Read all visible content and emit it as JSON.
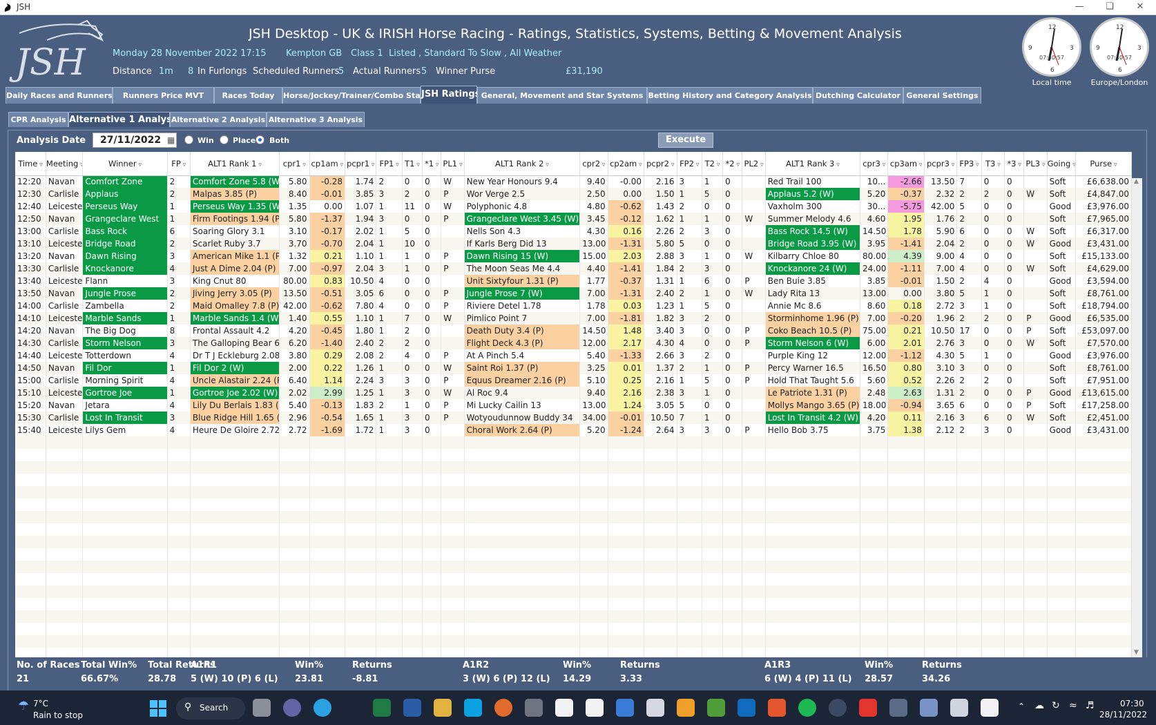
{
  "window": {
    "title": "JSH"
  },
  "header": {
    "title": "JSH Desktop - UK & IRISH Horse Racing  -  Ratings, Statistics, Systems, Betting & Movement Analysis",
    "date_time": "Monday 28 November 2022  17:15",
    "course": "Kempton  GB",
    "class": "Class 1",
    "race_type": "Listed , Standard To Slow , All Weather",
    "distance_label": "Distance",
    "distance": "1m",
    "furlongs_value": "8",
    "furlongs_label": "In Furlongs",
    "sched_label": "Scheduled Runners",
    "sched": "5",
    "actual_label": "Actual Runners",
    "actual": "5",
    "purse_label": "Winner Purse",
    "purse": "£31,190",
    "clock1_label": "Local time",
    "clock2_label": "Europe/London",
    "clock_time": "07:30:57"
  },
  "tabs": [
    {
      "label": "Daily Races and Runners",
      "active": false
    },
    {
      "label": "Runners Price MVT",
      "active": false
    },
    {
      "label": "Races Today",
      "active": false
    },
    {
      "label": "Horse/Jockey/Trainer/Combo Stats",
      "active": false
    },
    {
      "label": "JSH Ratings",
      "active": true
    },
    {
      "label": "General, Movement and Star Systems",
      "active": false
    },
    {
      "label": "Betting History and Category Analysis",
      "active": false
    },
    {
      "label": "Dutching Calculator",
      "active": false
    },
    {
      "label": "General Settings",
      "active": false
    }
  ],
  "subtabs": [
    {
      "label": "CPR Analysis",
      "active": false
    },
    {
      "label": "Alternative 1 Analysis",
      "active": true
    },
    {
      "label": "Alternative 2 Analysis",
      "active": false
    },
    {
      "label": "Alternative 3 Analysis",
      "active": false
    }
  ],
  "controls": {
    "analysis_date_label": "Analysis Date",
    "analysis_date": "27/11/2022",
    "radio_win": "Win",
    "radio_place": "Place",
    "radio_both": "Both",
    "selected": "Both",
    "execute": "Execute"
  },
  "columns": [
    "Time",
    "Meeting",
    "Winner",
    "FP",
    "ALT1 Rank 1",
    "cpr1",
    "cp1am",
    "pcpr1",
    "FP1",
    "T1",
    "*1",
    "PL1",
    "ALT1 Rank 2",
    "cpr2",
    "cp2am",
    "pcpr2",
    "FP2",
    "T2",
    "*2",
    "PL2",
    "ALT1 Rank 3",
    "cpr3",
    "cp3am",
    "pcpr3",
    "FP3",
    "T3",
    "*3",
    "PL3",
    "Going",
    "Purse"
  ],
  "rows": [
    [
      "12:20",
      "Navan",
      "Comfort Zone",
      "2",
      "Comfort Zone 5.8 (W)",
      "5.80",
      "-0.28",
      "1.74",
      "2",
      "0",
      "0",
      "W",
      "New Year Honours 9.4",
      "9.40",
      "-0.00",
      "2.16",
      "3",
      "1",
      "0",
      "",
      "Red Trail 100",
      "10...",
      "-2.66",
      "13.50",
      "7",
      "0",
      "0",
      "",
      "Soft",
      "£6,638.00"
    ],
    [
      "12:30",
      "Carlisle",
      "Applaus",
      "2",
      "Malpas 3.85 (P)",
      "8.40",
      "-0.01",
      "3.85",
      "3",
      "2",
      "0",
      "P",
      "Wor Verge 2.5",
      "2.50",
      "0.00",
      "1.50",
      "1",
      "5",
      "0",
      "",
      "Applaus 5.2 (W)",
      "5.20",
      "-0.37",
      "2.32",
      "2",
      "2",
      "0",
      "W",
      "Soft",
      "£4,847.00"
    ],
    [
      "12:40",
      "Leicester",
      "Perseus Way",
      "1",
      "Perseus Way 1.35 (W)",
      "1.35",
      "0.00",
      "1.07",
      "1",
      "11",
      "0",
      "W",
      "Polyphonic 4.8",
      "4.80",
      "-0.62",
      "1.43",
      "2",
      "0",
      "0",
      "",
      "Vaxholm 300",
      "30...",
      "-5.75",
      "42.00",
      "5",
      "0",
      "0",
      "",
      "Good",
      "£3,976.00"
    ],
    [
      "12:50",
      "Navan",
      "Grangeclare West",
      "1",
      "Firm Footings 1.94 (P)",
      "5.80",
      "-1.37",
      "1.94",
      "3",
      "0",
      "0",
      "P",
      "Grangeclare West 3.45 (W)",
      "3.45",
      "-0.12",
      "1.62",
      "1",
      "1",
      "0",
      "W",
      "Summer Melody 4.6",
      "4.60",
      "1.95",
      "1.76",
      "2",
      "0",
      "0",
      "",
      "Soft",
      "£7,965.00"
    ],
    [
      "13:00",
      "Carlisle",
      "Bass Rock",
      "6",
      "Soaring Glory 3.1",
      "3.10",
      "-0.17",
      "2.02",
      "1",
      "5",
      "0",
      "",
      "Nells Son 4.3",
      "4.30",
      "0.16",
      "2.26",
      "2",
      "3",
      "0",
      "",
      "Bass Rock 14.5 (W)",
      "14.50",
      "1.78",
      "5.90",
      "6",
      "0",
      "0",
      "W",
      "Soft",
      "£6,317.00"
    ],
    [
      "13:10",
      "Leicester",
      "Bridge Road",
      "2",
      "Scarlet Ruby 3.7",
      "3.70",
      "-0.70",
      "2.04",
      "1",
      "10",
      "0",
      "",
      "If Karls Berg Did 13",
      "13.00",
      "-1.31",
      "5.80",
      "5",
      "0",
      "0",
      "",
      "Bridge Road 3.95 (W)",
      "3.95",
      "-1.41",
      "2.04",
      "2",
      "0",
      "0",
      "W",
      "Good",
      "£3,431.00"
    ],
    [
      "13:20",
      "Navan",
      "Dawn Rising",
      "3",
      "American Mike 1.1 (P)",
      "1.32",
      "0.21",
      "1.10",
      "1",
      "1",
      "0",
      "P",
      "Dawn Rising 15 (W)",
      "15.00",
      "2.03",
      "2.88",
      "3",
      "1",
      "0",
      "W",
      "Kilbarry Chloe 80",
      "80.00",
      "4.39",
      "9.00",
      "4",
      "0",
      "0",
      "",
      "Soft",
      "£15,133.00"
    ],
    [
      "13:30",
      "Carlisle",
      "Knockanore",
      "4",
      "Just A Dime 2.04 (P)",
      "7.00",
      "-0.97",
      "2.04",
      "3",
      "1",
      "0",
      "P",
      "The Moon Seas Me 4.4",
      "4.40",
      "-1.41",
      "1.84",
      "2",
      "3",
      "0",
      "",
      "Knockanore 24 (W)",
      "24.00",
      "-1.11",
      "7.00",
      "4",
      "0",
      "0",
      "W",
      "Soft",
      "£4,629.00"
    ],
    [
      "13:40",
      "Leicester",
      "Flann",
      "3",
      "King Cnut 80",
      "80.00",
      "0.83",
      "10.50",
      "4",
      "0",
      "0",
      "",
      "Unit Sixtyfour 1.31 (P)",
      "1.77",
      "-0.37",
      "1.31",
      "1",
      "6",
      "0",
      "P",
      "Ben Buie 3.85",
      "3.85",
      "-0.01",
      "1.50",
      "2",
      "4",
      "0",
      "",
      "Good",
      "£3,594.00"
    ],
    [
      "13:50",
      "Navan",
      "Jungle Prose",
      "2",
      "Jiving Jerry 3.05 (P)",
      "13.50",
      "-0.51",
      "3.05",
      "6",
      "0",
      "0",
      "P",
      "Jungle Prose 7 (W)",
      "7.00",
      "-1.31",
      "2.40",
      "2",
      "1",
      "0",
      "W",
      "Lady Rita 13",
      "13.00",
      "0.00",
      "3.80",
      "5",
      "1",
      "0",
      "",
      "Soft",
      "£8,761.00"
    ],
    [
      "14:00",
      "Carlisle",
      "Zambella",
      "2",
      "Maid Omalley 7.8 (P)",
      "42.00",
      "-0.62",
      "7.80",
      "4",
      "0",
      "0",
      "P",
      "Riviere Detel 1.78",
      "1.78",
      "0.03",
      "1.23",
      "1",
      "5",
      "0",
      "",
      "Annie Mc 8.6",
      "8.60",
      "0.18",
      "2.72",
      "3",
      "1",
      "0",
      "",
      "Soft",
      "£18,794.00"
    ],
    [
      "14:10",
      "Leicester",
      "Marble Sands",
      "1",
      "Marble Sands 1.4 (W)",
      "1.40",
      "0.55",
      "1.10",
      "1",
      "7",
      "0",
      "W",
      "Pimlico Point 7",
      "7.00",
      "-1.81",
      "1.82",
      "3",
      "2",
      "0",
      "",
      "Storminhome 1.96 (P)",
      "7.00",
      "-0.20",
      "1.96",
      "2",
      "2",
      "0",
      "P",
      "Good",
      "£6,535.00"
    ],
    [
      "14:20",
      "Navan",
      "The Big Dog",
      "8",
      "Frontal Assault 4.2",
      "4.20",
      "-0.45",
      "1.80",
      "1",
      "2",
      "0",
      "",
      "Death Duty 3.4 (P)",
      "14.50",
      "1.48",
      "3.40",
      "3",
      "0",
      "0",
      "P",
      "Coko Beach 10.5 (P)",
      "75.00",
      "0.21",
      "10.50",
      "17",
      "0",
      "0",
      "P",
      "Soft",
      "£53,097.00"
    ],
    [
      "14:30",
      "Carlisle",
      "Storm Nelson",
      "3",
      "The Galloping Bear 6",
      "6.20",
      "-1.40",
      "2.40",
      "2",
      "2",
      "0",
      "",
      "Flight Deck 4.3 (P)",
      "12.00",
      "2.17",
      "4.30",
      "4",
      "0",
      "0",
      "P",
      "Storm Nelson 6 (W)",
      "6.00",
      "2.01",
      "2.76",
      "3",
      "0",
      "0",
      "W",
      "Soft",
      "£7,570.00"
    ],
    [
      "14:40",
      "Leicester",
      "Totterdown",
      "4",
      "Dr T J Eckleburg 2.08",
      "3.80",
      "0.29",
      "2.08",
      "2",
      "4",
      "0",
      "P",
      "At A Pinch 5.4",
      "5.40",
      "-1.33",
      "2.66",
      "3",
      "2",
      "0",
      "",
      "Purple King 12",
      "12.00",
      "-1.12",
      "4.30",
      "5",
      "1",
      "0",
      "",
      "Good",
      "£3,976.00"
    ],
    [
      "14:50",
      "Navan",
      "Fil Dor",
      "1",
      "Fil Dor 2 (W)",
      "2.00",
      "0.22",
      "1.26",
      "1",
      "0",
      "0",
      "W",
      "Saint Roi 1.37 (P)",
      "3.25",
      "0.01",
      "1.37",
      "2",
      "1",
      "0",
      "P",
      "Percy Warner 16.5",
      "16.50",
      "0.80",
      "3.10",
      "3",
      "0",
      "0",
      "",
      "Soft",
      "£8,761.00"
    ],
    [
      "15:00",
      "Carlisle",
      "Morning Spirit",
      "4",
      "Uncle Alastair 2.24 (P)",
      "6.40",
      "1.14",
      "2.24",
      "3",
      "3",
      "0",
      "P",
      "Equus Dreamer 2.16 (P)",
      "5.10",
      "0.25",
      "2.16",
      "1",
      "5",
      "0",
      "P",
      "Hold That Taught 5.6",
      "5.60",
      "0.52",
      "2.26",
      "2",
      "2",
      "0",
      "",
      "Soft",
      "£7,951.00"
    ],
    [
      "15:10",
      "Leicester",
      "Gortroe Joe",
      "1",
      "Gortroe Joe 2.02 (W)",
      "2.02",
      "2.99",
      "1.25",
      "1",
      "3",
      "0",
      "W",
      "Al Roc 9.4",
      "9.40",
      "2.16",
      "2.38",
      "3",
      "1",
      "0",
      "",
      "Le Patriote 1.31 (P)",
      "2.48",
      "2.63",
      "1.31",
      "2",
      "0",
      "0",
      "P",
      "Good",
      "£13,615.00"
    ],
    [
      "15:20",
      "Navan",
      "Jetara",
      "4",
      "Lily Du Berlais 1.83 (P)",
      "5.40",
      "-0.13",
      "1.83",
      "2",
      "1",
      "0",
      "P",
      "Mi Lucky Cailin 13",
      "13.00",
      "1.24",
      "3.05",
      "5",
      "0",
      "0",
      "",
      "Mollys Mango 3.65 (P)",
      "18.00",
      "-0.94",
      "3.65",
      "6",
      "0",
      "0",
      "P",
      "Soft",
      "£17,258.00"
    ],
    [
      "15:30",
      "Carlisle",
      "Lost In Transit",
      "3",
      "Blue Ridge Hill 1.65 (P)",
      "2.96",
      "-0.54",
      "1.65",
      "1",
      "3",
      "0",
      "P",
      "Wotyoudunnow Buddy 34",
      "34.00",
      "-0.01",
      "10.50",
      "7",
      "1",
      "0",
      "",
      "Lost In Transit 4.2 (W)",
      "4.20",
      "0.11",
      "2.16",
      "3",
      "6",
      "0",
      "W",
      "Soft",
      "£2,451.00"
    ],
    [
      "15:40",
      "Leicester",
      "Lilys Gem",
      "4",
      "Heure De Gloire 2.72",
      "2.72",
      "-1.69",
      "1.72",
      "1",
      "3",
      "0",
      "",
      "Choral Work 2.64 (P)",
      "5.20",
      "-1.24",
      "2.64",
      "3",
      "3",
      "0",
      "P",
      "Hello Bob 3.75",
      "3.75",
      "1.38",
      "2.12",
      "2",
      "3",
      "0",
      "",
      "Good",
      "£3,431.00"
    ]
  ],
  "cell_colors": {
    "green": "#0a9a46",
    "orange": "#fbd1a2",
    "yellow": "#f8f4a1",
    "light_green": "#cdeec9",
    "pink": "#f49be0"
  },
  "footer": {
    "h1": "No. of Races",
    "v1": "21",
    "h2": "Total Win%",
    "v2": "66.67%",
    "h3": "Total Returns",
    "v3": "28.78",
    "a1r1_label": "A1R1",
    "a1r1": "5 (W) 10 (P) 6 (L)",
    "w1_label": "Win%",
    "w1": "23.81",
    "r1_label": "Returns",
    "r1": "-8.81",
    "a1r2_label": "A1R2",
    "a1r2": "3 (W) 6 (P) 12 (L)",
    "w2_label": "Win%",
    "w2": "14.29",
    "r2_label": "Returns",
    "r2": "3.33",
    "a1r3_label": "A1R3",
    "a1r3": "6 (W) 4 (P) 11 (L)",
    "w3_label": "Win%",
    "w3": "28.57",
    "r3_label": "Returns",
    "r3": "34.26"
  },
  "taskbar": {
    "temp": "7°C",
    "weather": "Rain to stop",
    "search": "Search",
    "time": "07:30",
    "date": "28/11/2022"
  }
}
